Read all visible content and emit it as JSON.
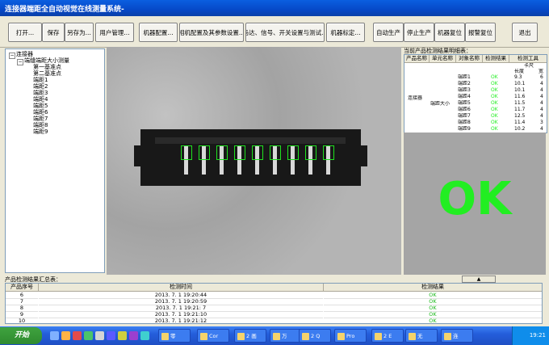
{
  "window": {
    "title": "连接器端距全自动视觉在线测量系统-"
  },
  "toolbar": {
    "buttons": [
      "打开...",
      "保存",
      "另存为...",
      "用户管理...",
      "机器配置...",
      "相机配置及其参数设置...",
      "马达、信号、开关设置与测试...",
      "机器标定...",
      "自动生产",
      "停止生产",
      "机器复位",
      "报警复位",
      "退出"
    ]
  },
  "tree": {
    "root": "连接器",
    "child": "端缝端距大小测量",
    "items": [
      "第一基准点",
      "第二基准点",
      "端距1",
      "端距2",
      "端距3",
      "端距4",
      "端距5",
      "端距6",
      "端距7",
      "端距8",
      "端距9"
    ]
  },
  "results": {
    "label": "当前产品检测结果明细表：",
    "headers": [
      "产品名称",
      "单元名称",
      "对象名称",
      "检测结果",
      "检测工具"
    ],
    "subheader": "卡尺",
    "subcolumns": [
      "长度",
      "宽"
    ],
    "product": "连接器",
    "unit": "端距大小",
    "rows": [
      {
        "name": "端距1",
        "result": "OK",
        "length": "9.3",
        "w": "6"
      },
      {
        "name": "端距2",
        "result": "OK",
        "length": "10.1",
        "w": "4"
      },
      {
        "name": "端距3",
        "result": "OK",
        "length": "10.1",
        "w": "4"
      },
      {
        "name": "端距4",
        "result": "OK",
        "length": "11.6",
        "w": "4"
      },
      {
        "name": "端距5",
        "result": "OK",
        "length": "11.5",
        "w": "4"
      },
      {
        "name": "端距6",
        "result": "OK",
        "length": "11.7",
        "w": "4"
      },
      {
        "name": "端距7",
        "result": "OK",
        "length": "12.5",
        "w": "4"
      },
      {
        "name": "端距8",
        "result": "OK",
        "length": "11.4",
        "w": "3"
      },
      {
        "name": "端距9",
        "result": "OK",
        "length": "10.2",
        "w": "4"
      }
    ]
  },
  "status": {
    "big": "OK",
    "color": "#22ee22",
    "scroll_glyph": "▲"
  },
  "summary": {
    "label": "产品检测结果汇总表：",
    "headers": [
      "产品序号",
      "检测时间",
      "检测结果"
    ],
    "rows": [
      {
        "id": "6",
        "time": "2013. 7. 1 19:20:44",
        "result": "OK"
      },
      {
        "id": "7",
        "time": "2013. 7. 1 19:20:59",
        "result": "OK"
      },
      {
        "id": "8",
        "time": "2013. 7. 1 19:21: 7",
        "result": "OK"
      },
      {
        "id": "9",
        "time": "2013. 7. 1 19:21:10",
        "result": "OK"
      },
      {
        "id": "10",
        "time": "2013. 7. 1 19:21:12",
        "result": "OK"
      }
    ]
  },
  "taskbar": {
    "start": "开始",
    "tasks": [
      "零",
      "Cor",
      "2 画",
      "万",
      "2 Q",
      "Pro",
      "2 E",
      "无",
      "连"
    ],
    "clock": "19:21"
  }
}
